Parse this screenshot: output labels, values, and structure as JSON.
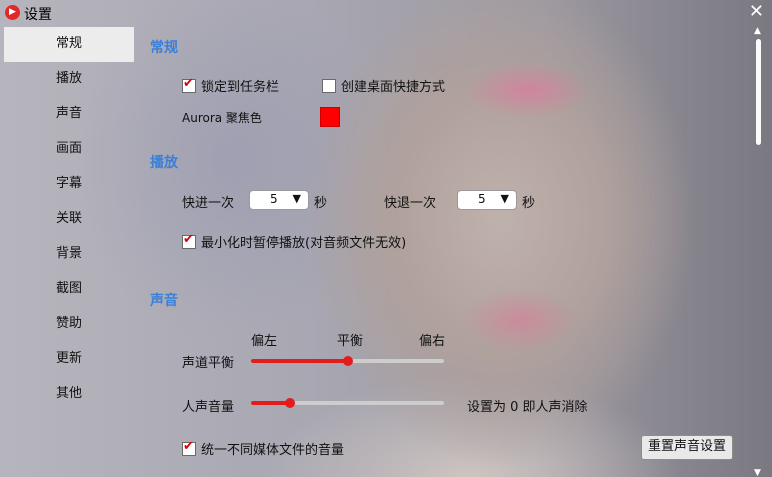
{
  "window": {
    "title": "设置",
    "close_glyph": "✕",
    "logo_glyph": "▶"
  },
  "sidebar": {
    "items": [
      {
        "label": "常规"
      },
      {
        "label": "播放"
      },
      {
        "label": "声音"
      },
      {
        "label": "画面"
      },
      {
        "label": "字幕"
      },
      {
        "label": "关联"
      },
      {
        "label": "背景"
      },
      {
        "label": "截图"
      },
      {
        "label": "赞助"
      },
      {
        "label": "更新"
      },
      {
        "label": "其他"
      }
    ],
    "active": "常规"
  },
  "general": {
    "heading": "常规",
    "pin_taskbar": {
      "label": "锁定到任务栏",
      "checked": true
    },
    "desktop_shortcut": {
      "label": "创建桌面快捷方式",
      "checked": false
    },
    "aurora_label": "Aurora 聚焦色",
    "aurora_color": "#ff0000"
  },
  "playback": {
    "heading": "播放",
    "forward_label": "快进一次",
    "forward_value": "5",
    "forward_unit": "秒",
    "backward_label": "快退一次",
    "backward_value": "5",
    "backward_unit": "秒",
    "pause_minimized": {
      "label": "最小化时暂停播放(对音频文件无效)",
      "checked": true
    }
  },
  "sound": {
    "heading": "声音",
    "balance_left": "偏左",
    "balance_center": "平衡",
    "balance_right": "偏右",
    "balance_label": "声道平衡",
    "balance_value": 0.5,
    "vocal_label": "人声音量",
    "vocal_value": 0.2,
    "vocal_hint": "设置为 0 即人声消除",
    "unify_volume": {
      "label": "统一不同媒体文件的音量",
      "checked": true
    },
    "reset_button": "重置声音设置"
  },
  "colors": {
    "accent": "#e41c1c",
    "heading": "#3a7fd8"
  },
  "icons": {
    "dropdown": "▼",
    "scroll_up": "▲",
    "scroll_down": "▼"
  }
}
